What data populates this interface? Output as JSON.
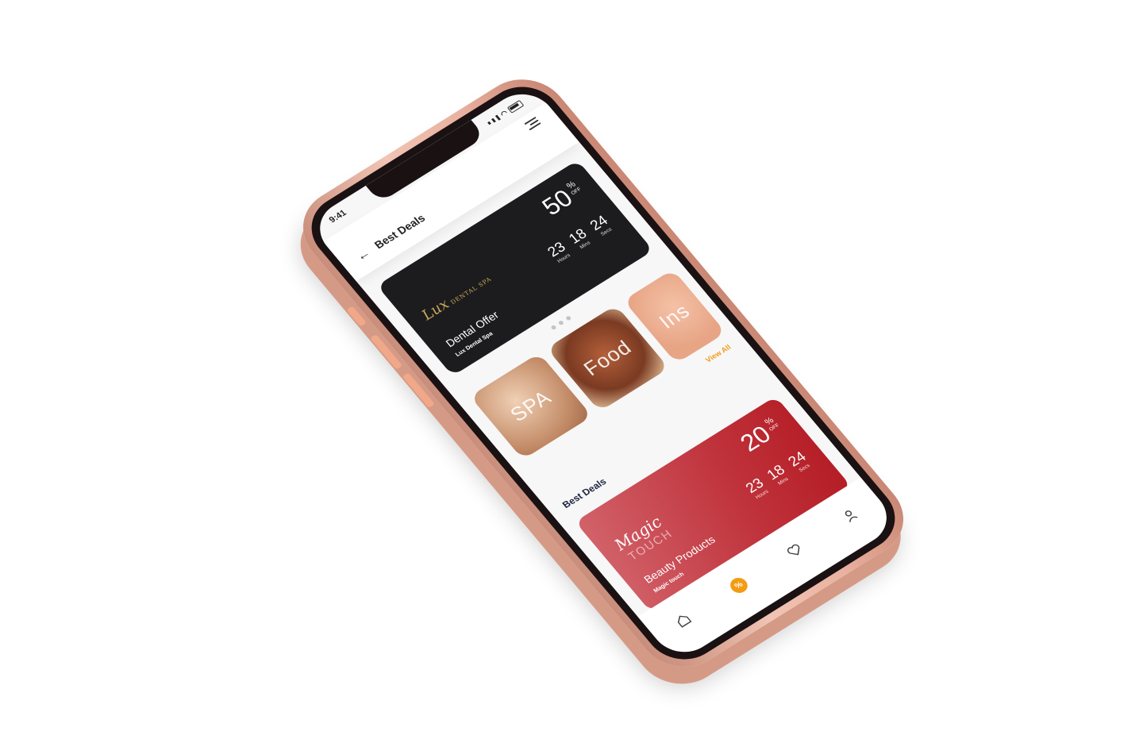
{
  "status_bar": {
    "time": "9:41"
  },
  "header": {
    "title": "Best Deals"
  },
  "top_deal": {
    "brand": "Lux",
    "brand_sub": "DENTAL SPA",
    "discount": "50",
    "discount_unit": "%",
    "discount_off": "OFF",
    "countdown": [
      {
        "value": "23",
        "label": "Hours"
      },
      {
        "value": "18",
        "label": "Mins"
      },
      {
        "value": "24",
        "label": "Secs"
      }
    ],
    "title": "Dental Offer",
    "subtitle": "Lux Dental Spa"
  },
  "categories": [
    {
      "label": "SPA"
    },
    {
      "label": "Food"
    },
    {
      "label": "Ins"
    }
  ],
  "view_all": "View All",
  "section_title": "Best Deals",
  "bottom_deal": {
    "brand": "Magic",
    "brand_sub": "TOUCH",
    "discount": "20",
    "discount_unit": "%",
    "discount_off": "OFF",
    "countdown": [
      {
        "value": "23",
        "label": "Hours"
      },
      {
        "value": "18",
        "label": "Mins"
      },
      {
        "value": "24",
        "label": "Secs"
      }
    ],
    "title": "Beauty Products",
    "subtitle": "Magic touch"
  },
  "tab_icons": [
    "home-icon",
    "deals-icon",
    "heart-icon",
    "profile-icon"
  ],
  "colors": {
    "accent": "#f39c12",
    "dark_card": "#1c1c1e",
    "red_card": "#c0333c",
    "phone": "#e9b19f"
  }
}
